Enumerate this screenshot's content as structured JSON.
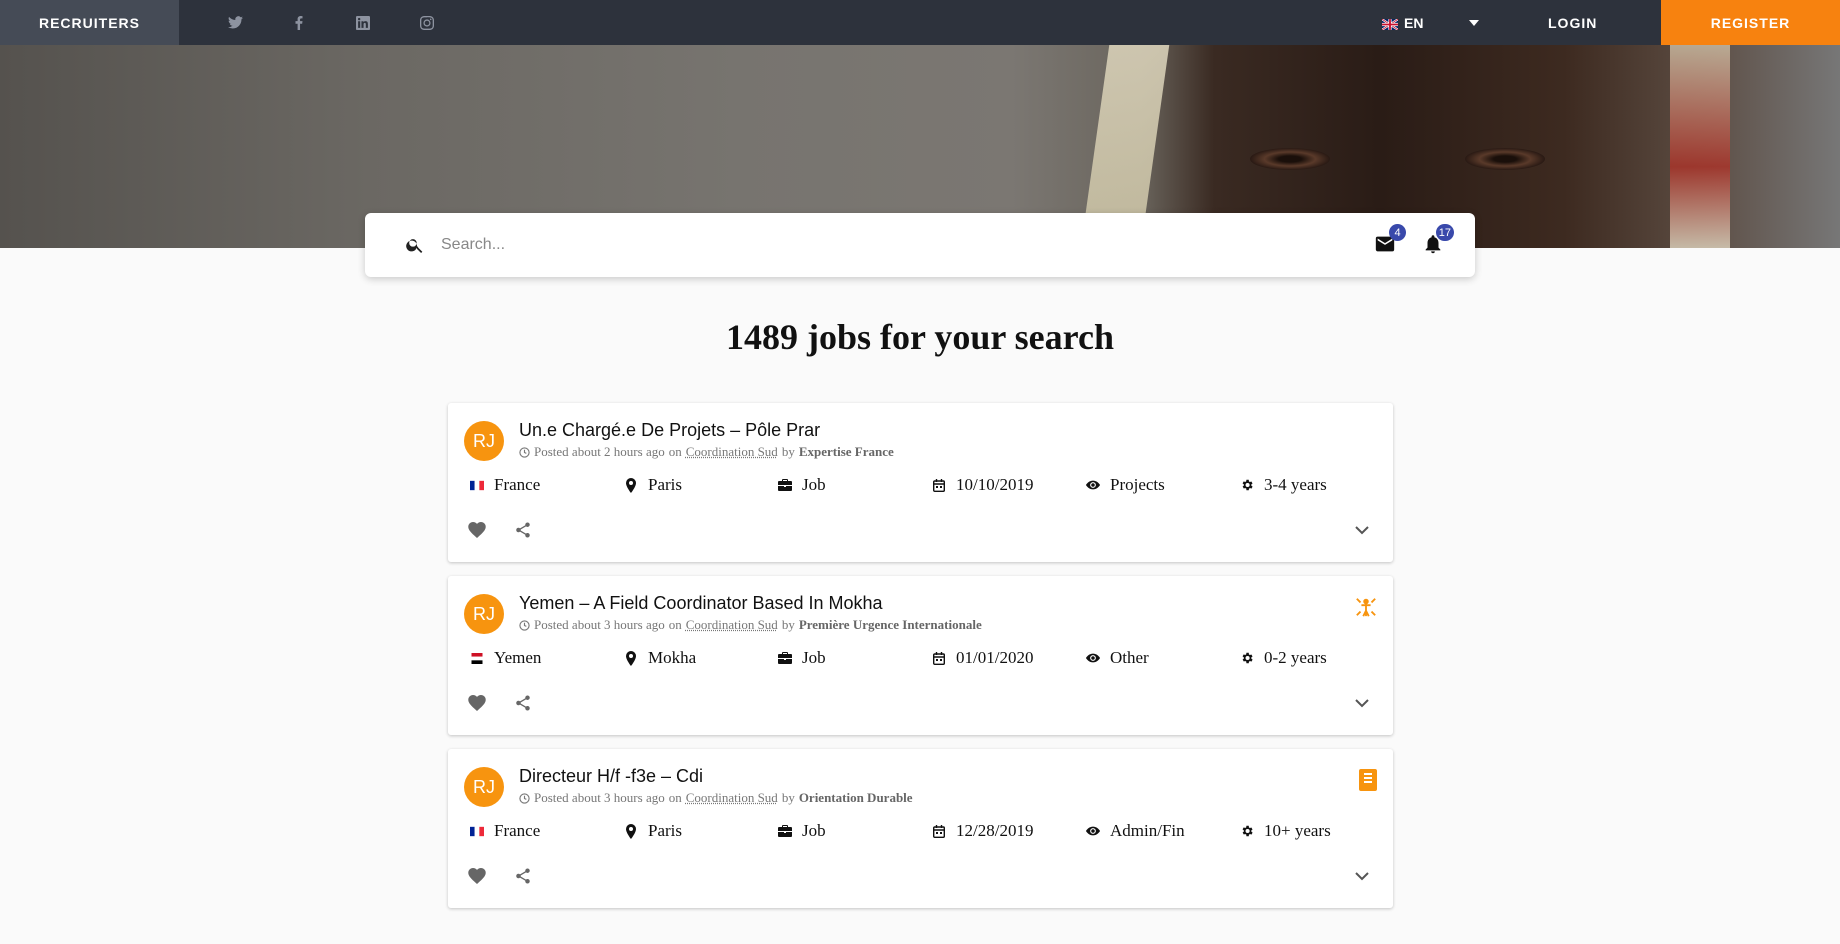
{
  "topbar": {
    "recruiters": "RECRUITERS",
    "social_icons": [
      "twitter-icon",
      "facebook-icon",
      "linkedin-icon",
      "instagram-icon"
    ],
    "language": "EN",
    "login": "LOGIN",
    "register": "REGISTER",
    "register_color": "#f7820f"
  },
  "search": {
    "placeholder": "Search...",
    "messages_count": "4",
    "notifications_count": "17"
  },
  "results": {
    "title": "1489 jobs for your search"
  },
  "jobs": [
    {
      "avatar": "RJ",
      "title": "Un.e Chargé.e De Projets – Pôle Prar",
      "posted": "Posted about 2 hours ago",
      "on": "on",
      "source": "Coordination Sud",
      "by": "by",
      "organization": "Expertise France",
      "country": "France",
      "city": "Paris",
      "type": "Job",
      "date": "10/10/2019",
      "category": "Projects",
      "experience": "3-4 years",
      "category_icon": ""
    },
    {
      "avatar": "RJ",
      "title": "Yemen – A Field Coordinator Based In Mokha",
      "posted": "Posted about 3 hours ago",
      "on": "on",
      "source": "Coordination Sud",
      "by": "by",
      "organization": "Première Urgence Internationale",
      "country": "Yemen",
      "city": "Mokha",
      "type": "Job",
      "date": "01/01/2020",
      "category": "Other",
      "experience": "0-2 years",
      "category_icon": "humanitarian-icon"
    },
    {
      "avatar": "RJ",
      "title": "Directeur H/f -f3e – Cdi",
      "posted": "Posted about 3 hours ago",
      "on": "on",
      "source": "Coordination Sud",
      "by": "by",
      "organization": "Orientation Durable",
      "country": "France",
      "city": "Paris",
      "type": "Job",
      "date": "12/28/2019",
      "category": "Admin/Fin",
      "experience": "10+ years",
      "category_icon": "document-icon"
    }
  ]
}
